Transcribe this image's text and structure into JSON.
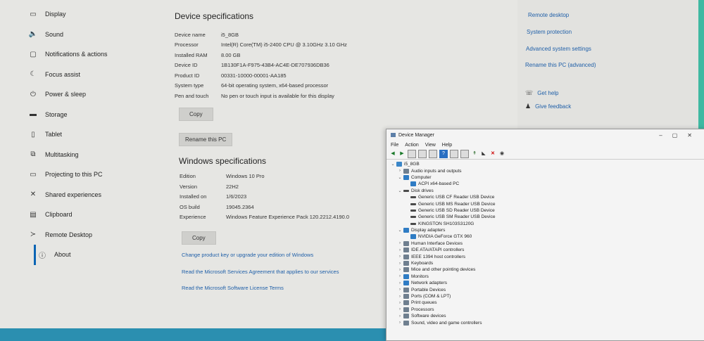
{
  "sidebar": {
    "items": [
      {
        "label": "Display",
        "icon": "display-icon",
        "glyph": "▭"
      },
      {
        "label": "Sound",
        "icon": "sound-icon",
        "glyph": "🔈"
      },
      {
        "label": "Notifications & actions",
        "icon": "notifications-icon",
        "glyph": "▢"
      },
      {
        "label": "Focus assist",
        "icon": "focus-assist-icon",
        "glyph": "☾"
      },
      {
        "label": "Power & sleep",
        "icon": "power-icon",
        "glyph": "⏻"
      },
      {
        "label": "Storage",
        "icon": "storage-icon",
        "glyph": "▬"
      },
      {
        "label": "Tablet",
        "icon": "tablet-icon",
        "glyph": "▯"
      },
      {
        "label": "Multitasking",
        "icon": "multitasking-icon",
        "glyph": "⧉"
      },
      {
        "label": "Projecting to this PC",
        "icon": "projecting-icon",
        "glyph": "▭"
      },
      {
        "label": "Shared experiences",
        "icon": "shared-experiences-icon",
        "glyph": "✕"
      },
      {
        "label": "Clipboard",
        "icon": "clipboard-icon",
        "glyph": "▤"
      },
      {
        "label": "Remote Desktop",
        "icon": "remote-desktop-icon",
        "glyph": "≻"
      },
      {
        "label": "About",
        "icon": "info-icon",
        "glyph": "ⓘ"
      }
    ]
  },
  "device_specs": {
    "title": "Device specifications",
    "rows": [
      {
        "k": "Device name",
        "v": "i5_8GB"
      },
      {
        "k": "Processor",
        "v": "Intel(R) Core(TM) i5-2400 CPU @ 3.10GHz   3.10 GHz"
      },
      {
        "k": "Installed RAM",
        "v": "8.00 GB"
      },
      {
        "k": "Device ID",
        "v": "1B130F1A-F975-43B4-AC4E-DE707936DB36"
      },
      {
        "k": "Product ID",
        "v": "00331-10000-00001-AA185"
      },
      {
        "k": "System type",
        "v": "64-bit operating system, x64-based processor"
      },
      {
        "k": "Pen and touch",
        "v": "No pen or touch input is available for this display"
      }
    ],
    "copy_label": "Copy",
    "rename_label": "Rename this PC"
  },
  "windows_specs": {
    "title": "Windows specifications",
    "rows": [
      {
        "k": "Edition",
        "v": "Windows 10 Pro"
      },
      {
        "k": "Version",
        "v": "22H2"
      },
      {
        "k": "Installed on",
        "v": "1/6/2023"
      },
      {
        "k": "OS build",
        "v": "19045.2364"
      },
      {
        "k": "Experience",
        "v": "Windows Feature Experience Pack 120.2212.4190.0"
      }
    ],
    "copy_label": "Copy",
    "links": [
      "Change product key or upgrade your edition of Windows",
      "Read the Microsoft Services Agreement that applies to our services",
      "Read the Microsoft Software License Terms"
    ]
  },
  "related": {
    "links": [
      "Remote desktop",
      "System protection",
      "Advanced system settings",
      "Rename this PC (advanced)"
    ],
    "help": {
      "get_help": "Get help",
      "give_feedback": "Give feedback"
    }
  },
  "device_manager": {
    "title": "Device Manager",
    "menu": [
      "File",
      "Action",
      "View",
      "Help"
    ],
    "tree": [
      {
        "label": "i5_8GB",
        "level": 0,
        "toggle": "v",
        "icon": "root"
      },
      {
        "label": "Audio inputs and outputs",
        "level": 1,
        "toggle": ">",
        "icon": "other"
      },
      {
        "label": "Computer",
        "level": 1,
        "toggle": "v",
        "icon": "mon"
      },
      {
        "label": "ACPI x64-based PC",
        "level": 2,
        "toggle": "",
        "icon": "mon"
      },
      {
        "label": "Disk drives",
        "level": 1,
        "toggle": "v",
        "icon": "drive"
      },
      {
        "label": "Generic USB CF Reader USB Device",
        "level": 2,
        "toggle": "",
        "icon": "drive"
      },
      {
        "label": "Generic USB MS Reader USB Device",
        "level": 2,
        "toggle": "",
        "icon": "drive"
      },
      {
        "label": "Generic USB SD Reader USB Device",
        "level": 2,
        "toggle": "",
        "icon": "drive"
      },
      {
        "label": "Generic USB SM Reader USB Device",
        "level": 2,
        "toggle": "",
        "icon": "drive"
      },
      {
        "label": "KINGSTON SH103S3120G",
        "level": 2,
        "toggle": "",
        "icon": "drive"
      },
      {
        "label": "Display adapters",
        "level": 1,
        "toggle": "v",
        "icon": "mon"
      },
      {
        "label": "NVIDIA GeForce GTX 960",
        "level": 2,
        "toggle": "",
        "icon": "mon"
      },
      {
        "label": "Human Interface Devices",
        "level": 1,
        "toggle": ">",
        "icon": "other"
      },
      {
        "label": "IDE ATA/ATAPI controllers",
        "level": 1,
        "toggle": ">",
        "icon": "other"
      },
      {
        "label": "IEEE 1394 host controllers",
        "level": 1,
        "toggle": ">",
        "icon": "other"
      },
      {
        "label": "Keyboards",
        "level": 1,
        "toggle": ">",
        "icon": "other"
      },
      {
        "label": "Mice and other pointing devices",
        "level": 1,
        "toggle": ">",
        "icon": "other"
      },
      {
        "label": "Monitors",
        "level": 1,
        "toggle": ">",
        "icon": "mon"
      },
      {
        "label": "Network adapters",
        "level": 1,
        "toggle": ">",
        "icon": "mon"
      },
      {
        "label": "Portable Devices",
        "level": 1,
        "toggle": ">",
        "icon": "other"
      },
      {
        "label": "Ports (COM & LPT)",
        "level": 1,
        "toggle": ">",
        "icon": "other"
      },
      {
        "label": "Print queues",
        "level": 1,
        "toggle": ">",
        "icon": "other"
      },
      {
        "label": "Processors",
        "level": 1,
        "toggle": ">",
        "icon": "other"
      },
      {
        "label": "Software devices",
        "level": 1,
        "toggle": ">",
        "icon": "other"
      },
      {
        "label": "Sound, video and game controllers",
        "level": 1,
        "toggle": ">",
        "icon": "other"
      }
    ]
  }
}
